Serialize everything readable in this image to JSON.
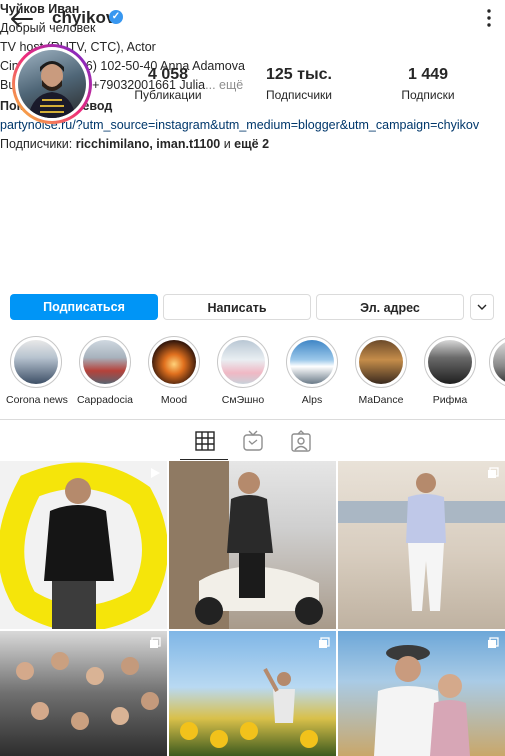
{
  "header": {
    "username": "chyikov",
    "verified_mark": "✓"
  },
  "stats": [
    {
      "value": "4 058",
      "label": "Публикации"
    },
    {
      "value": "125 тыс.",
      "label": "Подписчики"
    },
    {
      "value": "1 449",
      "label": "Подписки"
    }
  ],
  "bio": {
    "name": "Чуйков Иван",
    "lines": [
      "Добрый человек",
      "TV host (RUTV, CTC), Actor",
      "Cinema: +7 (916) 102-50-40  Anna Adamova"
    ],
    "business_line": "Business offers: +79032001661 Julia",
    "more_label": "... ещё",
    "translate": "Показать перевод",
    "link": "partynoise.ru/?utm_source=instagram&utm_medium=blogger&utm_campaign=chyikov",
    "followers_prefix": "Подписчики: ",
    "followers_names": "ricchimilano, iman.t1100",
    "followers_and": " и ",
    "followers_more": "ещё 2"
  },
  "actions": {
    "follow": "Подписаться",
    "message": "Написать",
    "email": "Эл. адрес"
  },
  "highlights": [
    {
      "label": "Corona news"
    },
    {
      "label": "Cappadocia"
    },
    {
      "label": "Mood"
    },
    {
      "label": "СмЭшно"
    },
    {
      "label": "Alps"
    },
    {
      "label": "MaDance"
    },
    {
      "label": "Рифма"
    },
    {
      "label": ""
    }
  ],
  "icons": {
    "back": "arrow-left-icon",
    "more": "more-vertical-icon",
    "grid": "grid-icon",
    "igtv": "igtv-icon",
    "tagged": "tagged-icon",
    "video": "play-icon",
    "album": "album-icon"
  },
  "colors": {
    "accent": "#0095f6",
    "verified": "#3897f0",
    "link": "#00376b",
    "muted": "#8e8e8e",
    "border": "#dbdbdb"
  }
}
